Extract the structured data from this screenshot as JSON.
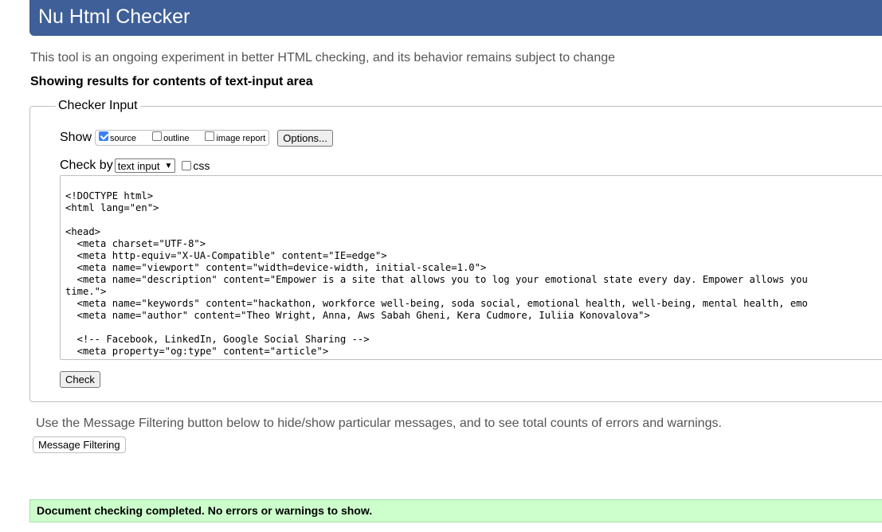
{
  "header": {
    "title": "Nu Html Checker"
  },
  "tagline": "This tool is an ongoing experiment in better HTML checking, and its behavior remains subject to change",
  "results_heading": "Showing results for contents of text-input area",
  "checker_input": {
    "legend": "Checker Input",
    "show_label": "Show",
    "show_options": [
      {
        "label": "source",
        "checked": true
      },
      {
        "label": "outline",
        "checked": false
      },
      {
        "label": "image report",
        "checked": false
      }
    ],
    "options_button": "Options...",
    "check_by_label": "Check by",
    "check_by_value": "text input",
    "css_label": "css",
    "css_checked": false,
    "code_lines": [
      "<!DOCTYPE html>",
      "<html lang=\"en\">",
      "",
      "<head>",
      "  <meta charset=\"UTF-8\">",
      "  <meta http-equiv=\"X-UA-Compatible\" content=\"IE=edge\">",
      "  <meta name=\"viewport\" content=\"width=device-width, initial-scale=1.0\">",
      "  <meta name=\"description\" content=\"Empower is a site that allows you to log your emotional state every day. Empower allows you",
      "time.\">",
      "  <meta name=\"keywords\" content=\"hackathon, workforce well-being, soda social, emotional health, well-being, mental health, emo",
      "  <meta name=\"author\" content=\"Theo Wright, Anna, Aws Sabah Gheni, Kera Cudmore, Iuliia Konovalova\">",
      "",
      "  <!-- Facebook, LinkedIn, Google Social Sharing -->",
      "  <meta property=\"og:type\" content=\"article\">"
    ],
    "check_button": "Check"
  },
  "filter_note": "Use the Message Filtering button below to hide/show particular messages, and to see total counts of errors and warnings.",
  "filter_button": "Message Filtering",
  "success_message": "Document checking completed. No errors or warnings to show.",
  "colors": {
    "header_bg": "#3e5f97",
    "success_bg": "#ccffcc",
    "checkbox_checked": "#3b82f6"
  }
}
